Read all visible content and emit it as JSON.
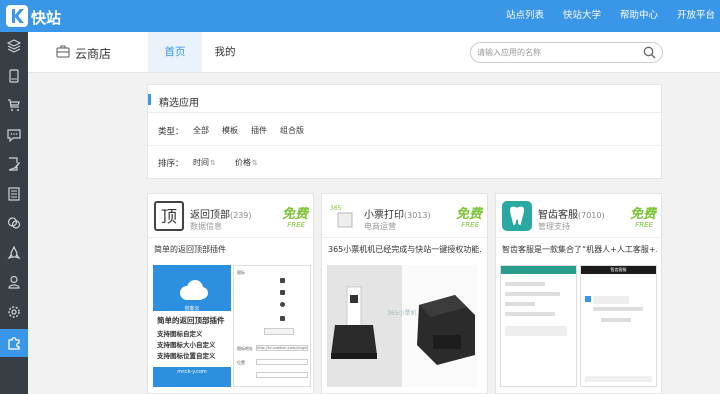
{
  "brand": {
    "name": "快站",
    "color": "#3a96e8"
  },
  "topnav": [
    "站点列表",
    "快站大学",
    "帮助中心",
    "开放平台"
  ],
  "sidebar": {
    "items": [
      "layers-icon",
      "mobile-icon",
      "cart-icon",
      "comment-icon",
      "edit-doc-icon",
      "list-icon",
      "chat-icon",
      "rocket-icon",
      "user-icon",
      "gear-icon",
      "puzzle-icon"
    ],
    "active_index": 10
  },
  "header": {
    "store_title": "云商店",
    "tabs": [
      "首页",
      "我的"
    ],
    "active_tab": 0,
    "search_placeholder": "请输入应用的名称"
  },
  "filter": {
    "section_title": "精选应用",
    "type_label": "类型：",
    "types": [
      "全部",
      "模板",
      "插件",
      "组合版"
    ],
    "sort_label": "排序：",
    "sorts": [
      "时间",
      "价格"
    ]
  },
  "cards": [
    {
      "name": "返回顶部",
      "count": "(239)",
      "category": "数据信息",
      "price_cn": "免费",
      "price_en": "FREE",
      "desc": "简单的返回顶部插件",
      "icon": "top-icon",
      "shot": {
        "brand": "创客云",
        "lines": [
          "简单的返回顶部插件",
          "支持图标自定义",
          "支持图标大小自定义",
          "支持图标位置自定义"
        ],
        "footer": "mcck-y.com",
        "fields": [
          "图标",
          "图标地址",
          "位置"
        ],
        "url_text": "http://kz.vuedian.com/plugin/backtop"
      }
    },
    {
      "name": "小票打印",
      "count": "(3013)",
      "category": "电商运营",
      "price_cn": "免费",
      "price_en": "FREE",
      "desc": "365小票机机已经完成与快站一键授权功能…",
      "icon": "receipt-icon",
      "shot": {
        "mark": "365小票机"
      }
    },
    {
      "name": "智齿客服",
      "count": "(7010)",
      "category": "管理支持",
      "price_cn": "免费",
      "price_en": "FREE",
      "desc": "智齿客服是一款集合了“机器人+人工客服+…",
      "icon": "tooth-icon",
      "shot": {
        "title": "智齿客服"
      }
    }
  ],
  "colors": {
    "topbar": "#3a96e8",
    "sidebar": "#383e44",
    "free": "#7cc335"
  }
}
